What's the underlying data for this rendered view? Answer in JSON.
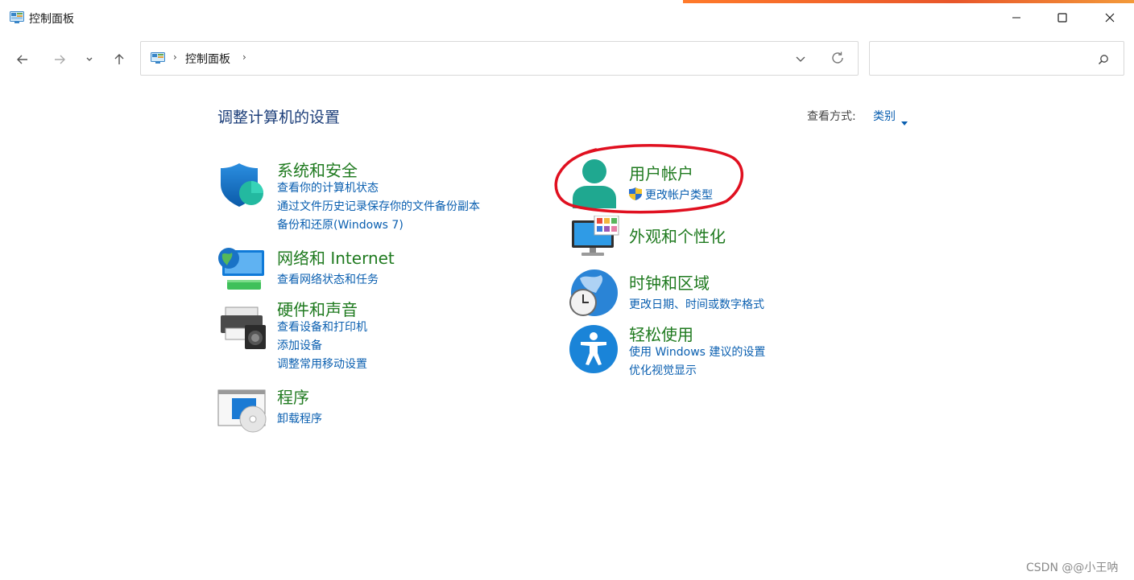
{
  "window": {
    "title": "控制面板"
  },
  "navigation": {
    "breadcrumb": [
      "控制面板"
    ],
    "search_value": "",
    "search_placeholder": ""
  },
  "main": {
    "heading": "调整计算机的设置",
    "view_by_label": "查看方式:",
    "view_by_value": "类别"
  },
  "categories_left": [
    {
      "title": "系统和安全",
      "icon": "shield-pie-icon",
      "links": [
        "查看你的计算机状态",
        "通过文件历史记录保存你的文件备份副本",
        "备份和还原(Windows 7)"
      ]
    },
    {
      "title": "网络和 Internet",
      "icon": "network-globe-icon",
      "links": [
        "查看网络状态和任务"
      ]
    },
    {
      "title": "硬件和声音",
      "icon": "printer-speaker-icon",
      "links": [
        "查看设备和打印机",
        "添加设备",
        "调整常用移动设置"
      ]
    },
    {
      "title": "程序",
      "icon": "programs-disc-icon",
      "links": [
        "卸载程序"
      ]
    }
  ],
  "categories_right": [
    {
      "title": "用户帐户",
      "icon": "user-account-icon",
      "links": [
        "更改帐户类型"
      ],
      "link_icon": "uac-shield-icon",
      "highlighted": true
    },
    {
      "title": "外观和个性化",
      "icon": "monitor-palette-icon",
      "links": []
    },
    {
      "title": "时钟和区域",
      "icon": "globe-clock-icon",
      "links": [
        "更改日期、时间或数字格式"
      ]
    },
    {
      "title": "轻松使用",
      "icon": "accessibility-icon",
      "links": [
        "使用 Windows 建议的设置",
        "优化视觉显示"
      ]
    }
  ],
  "annotation_color": "#e01020",
  "watermark": "CSDN @@小王呐"
}
